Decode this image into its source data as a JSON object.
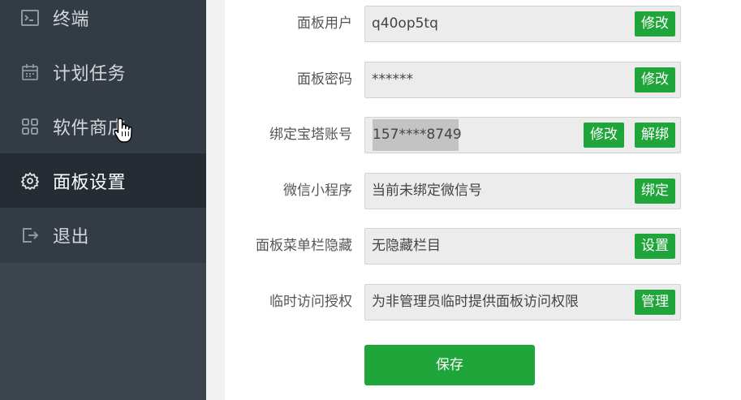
{
  "sidebar": {
    "items": [
      {
        "label": "终端",
        "icon": "terminal-icon"
      },
      {
        "label": "计划任务",
        "icon": "calendar-icon"
      },
      {
        "label": "软件商店",
        "icon": "grid-icon"
      },
      {
        "label": "面板设置",
        "icon": "gear-icon",
        "active": true
      },
      {
        "label": "退出",
        "icon": "logout-icon"
      }
    ]
  },
  "settings": {
    "panel_user": {
      "label": "面板用户",
      "value": "q40op5tq",
      "button": "修改"
    },
    "panel_password": {
      "label": "面板密码",
      "value": "******",
      "button": "修改"
    },
    "bt_account": {
      "label": "绑定宝塔账号",
      "value": "157****8749",
      "button_edit": "修改",
      "button_unbind": "解绑"
    },
    "wechat_app": {
      "label": "微信小程序",
      "value": "当前未绑定微信号",
      "button": "绑定"
    },
    "menu_hidden": {
      "label": "面板菜单栏隐藏",
      "value": "无隐藏栏目",
      "button": "设置"
    },
    "temp_access": {
      "label": "临时访问授权",
      "value": "为非管理员临时提供面板访问权限",
      "button": "管理"
    }
  },
  "save_label": "保存",
  "colors": {
    "accent_green": "#20a53a",
    "sidebar_bg": "#333b44",
    "sidebar_active_bg": "#262c33"
  }
}
